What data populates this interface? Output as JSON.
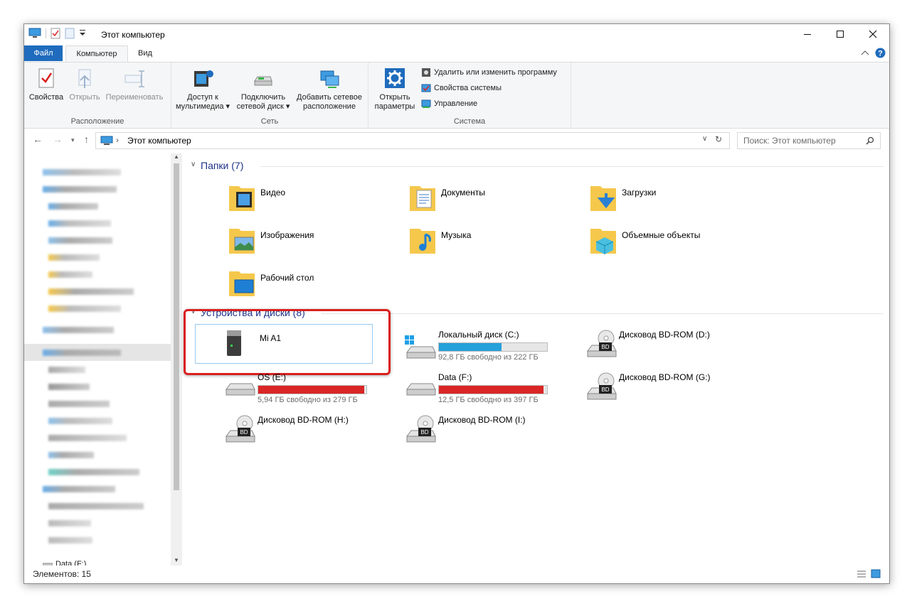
{
  "window": {
    "title": "Этот компьютер"
  },
  "tabs": {
    "file": "Файл",
    "computer": "Компьютер",
    "view": "Вид"
  },
  "ribbon": {
    "groups": {
      "location": "Расположение",
      "network": "Сеть",
      "system": "Система"
    },
    "location": {
      "properties": "Свойства",
      "open": "Открыть",
      "rename": "Переименовать"
    },
    "network": {
      "media_line1": "Доступ к",
      "media_line2": "мультимедиа",
      "map_line1": "Подключить",
      "map_line2": "сетевой диск",
      "add_line1": "Добавить сетевое",
      "add_line2": "расположение"
    },
    "system": {
      "settings_line1": "Открыть",
      "settings_line2": "параметры",
      "uninstall": "Удалить или изменить программу",
      "sys_props": "Свойства системы",
      "manage": "Управление"
    }
  },
  "address": {
    "path": "Этот компьютер",
    "search_placeholder": "Поиск: Этот компьютер"
  },
  "navpane": {
    "bottom_item": "Data (F:)"
  },
  "folders": {
    "header": "Папки (7)",
    "items": [
      "Видео",
      "Документы",
      "Загрузки",
      "Изображения",
      "Музыка",
      "Объемные объекты",
      "Рабочий стол"
    ]
  },
  "devices": {
    "header": "Устройства и диски (8)",
    "items": [
      {
        "name": "Mi A1"
      },
      {
        "name": "Локальный диск (C:)",
        "free": "92,8 ГБ свободно из 222 ГБ",
        "used_fraction": 0.58,
        "color": "#26a0da"
      },
      {
        "name": "Дисковод BD-ROM (D:)"
      },
      {
        "name": "OS (E:)",
        "free": "5,94 ГБ свободно из 279 ГБ",
        "used_fraction": 0.98,
        "color": "#da2626"
      },
      {
        "name": "Data (F:)",
        "free": "12,5 ГБ свободно из 397 ГБ",
        "used_fraction": 0.97,
        "color": "#da2626"
      },
      {
        "name": "Дисковод BD-ROM (G:)"
      },
      {
        "name": "Дисковод BD-ROM (H:)"
      },
      {
        "name": "Дисковод BD-ROM (I:)"
      }
    ]
  },
  "status": {
    "count": "Элементов: 15"
  },
  "colors": {
    "accent": "#1f6bbd",
    "highlight": "#d9201f",
    "folder": "#f5c84c"
  }
}
